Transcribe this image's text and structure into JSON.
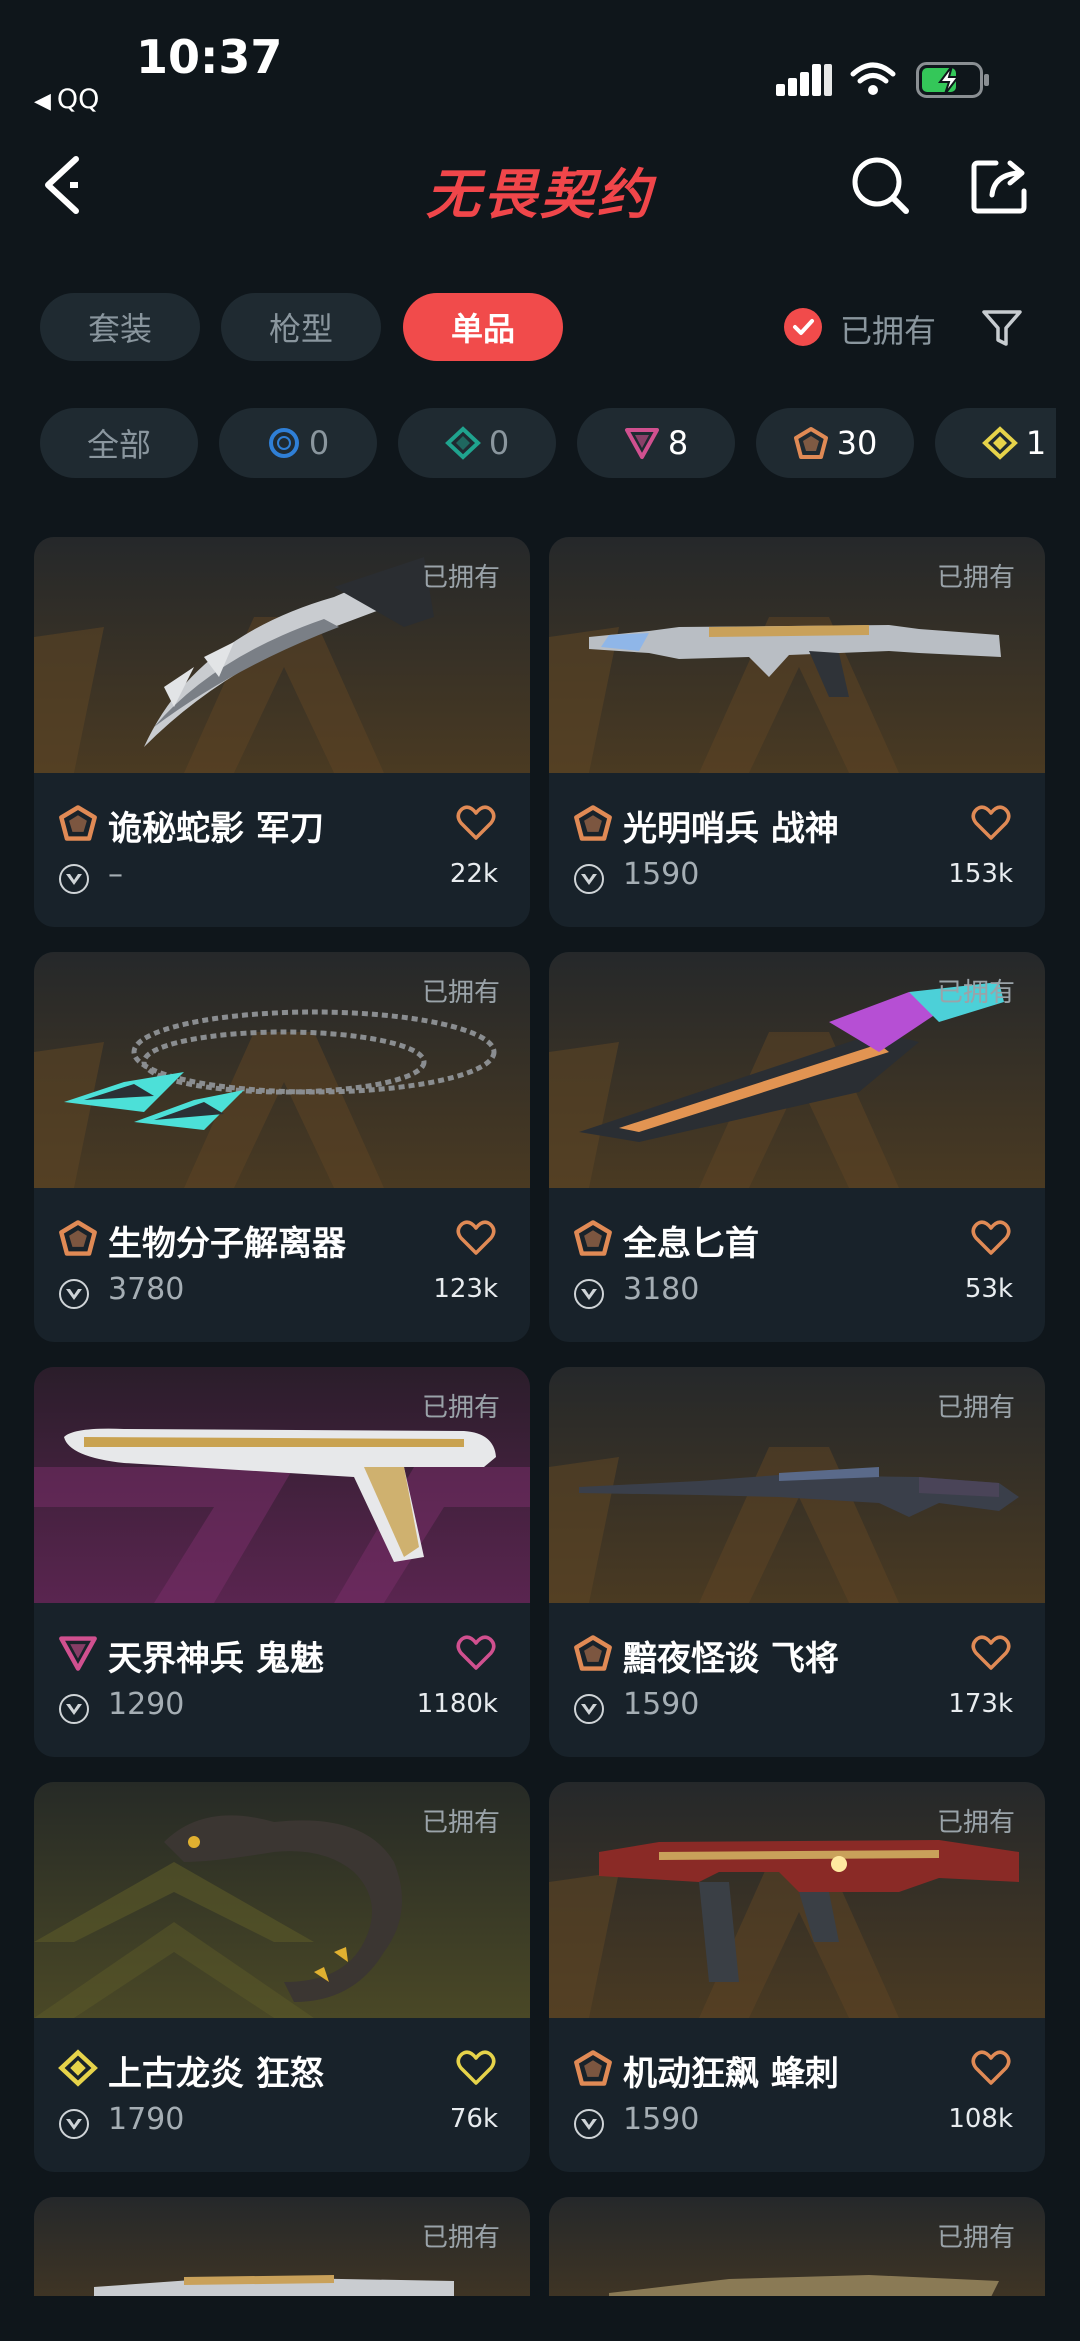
{
  "status_bar": {
    "time": "10:37",
    "back_app": "QQ"
  },
  "header": {
    "title": "无畏契约"
  },
  "tabs": [
    {
      "label": "套装",
      "active": false
    },
    {
      "label": "枪型",
      "active": false
    },
    {
      "label": "单品",
      "active": true
    }
  ],
  "owned_filter": {
    "label": "已拥有",
    "checked": true
  },
  "rarity_chips": [
    {
      "label": "全部"
    },
    {
      "icon": "select-tier-icon",
      "color": "#2f7fd6",
      "count": "0"
    },
    {
      "icon": "deluxe-tier-icon",
      "color": "#1fa38e",
      "count": "0"
    },
    {
      "icon": "premium-tier-icon",
      "color": "#d0508f",
      "count": "8"
    },
    {
      "icon": "exclusive-tier-icon",
      "color": "#e08a55",
      "count": "30"
    },
    {
      "icon": "ultra-tier-icon",
      "color": "#e6d34a",
      "count": "1"
    }
  ],
  "items": [
    {
      "name": "诡秘蛇影 军刀",
      "price": "–",
      "likes": "22k",
      "owned": "已拥有",
      "tier": "exclusive-tier-icon",
      "tier_color": "#e08a55",
      "bg": "orange"
    },
    {
      "name": "光明哨兵 战神",
      "price": "1590",
      "likes": "153k",
      "owned": "已拥有",
      "tier": "exclusive-tier-icon",
      "tier_color": "#e08a55",
      "bg": "orange"
    },
    {
      "name": "生物分子解离器",
      "price": "3780",
      "likes": "123k",
      "owned": "已拥有",
      "tier": "exclusive-tier-icon",
      "tier_color": "#e08a55",
      "bg": "orange"
    },
    {
      "name": "全息匕首",
      "price": "3180",
      "likes": "53k",
      "owned": "已拥有",
      "tier": "exclusive-tier-icon",
      "tier_color": "#e08a55",
      "bg": "orange"
    },
    {
      "name": "天界神兵 鬼魅",
      "price": "1290",
      "likes": "1180k",
      "owned": "已拥有",
      "tier": "premium-tier-icon",
      "tier_color": "#d0508f",
      "bg": "purple"
    },
    {
      "name": "黯夜怪谈 飞将",
      "price": "1590",
      "likes": "173k",
      "owned": "已拥有",
      "tier": "exclusive-tier-icon",
      "tier_color": "#e08a55",
      "bg": "orange"
    },
    {
      "name": "上古龙炎 狂怒",
      "price": "1790",
      "likes": "76k",
      "owned": "已拥有",
      "tier": "ultra-tier-icon",
      "tier_color": "#e6d34a",
      "bg": "yellow"
    },
    {
      "name": "机动狂飙 蜂刺",
      "price": "1590",
      "likes": "108k",
      "owned": "已拥有",
      "tier": "exclusive-tier-icon",
      "tier_color": "#e08a55",
      "bg": "orange"
    },
    {
      "owned": "已拥有",
      "bg": "orange"
    },
    {
      "owned": "已拥有",
      "bg": "orange"
    }
  ]
}
